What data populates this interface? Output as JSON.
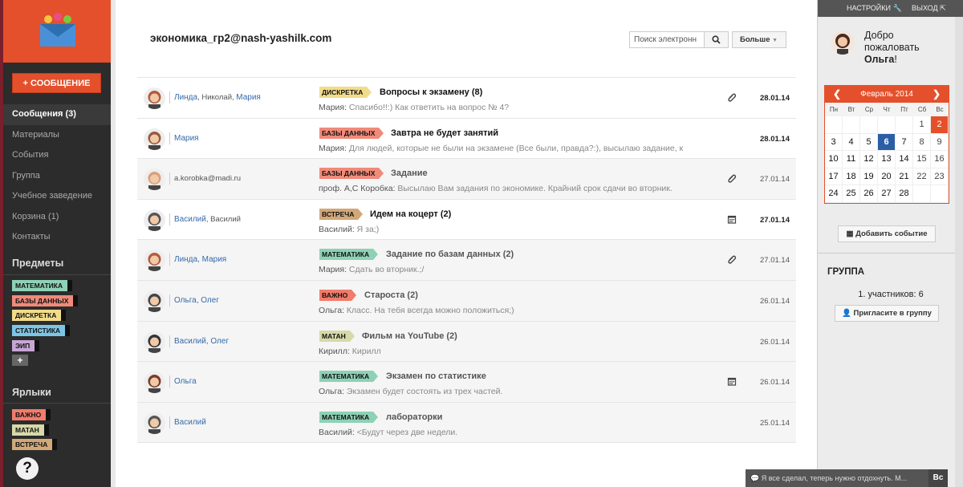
{
  "sidebar": {
    "compose_label": "+ СООБЩЕНИЕ",
    "nav": [
      {
        "label": "Сообщения (3)",
        "active": true
      },
      {
        "label": "Материалы",
        "active": false
      },
      {
        "label": "События",
        "active": false
      },
      {
        "label": "Группа",
        "active": false
      },
      {
        "label": "Учебное заведение",
        "active": false
      },
      {
        "label": "Корзина (1)",
        "active": false
      },
      {
        "label": "Контакты",
        "active": false
      }
    ],
    "subjects_title": "Предметы",
    "subjects": [
      {
        "label": "МАТЕМАТИКА",
        "color": "#8ed1b6"
      },
      {
        "label": "БАЗЫ ДАННЫХ",
        "color": "#f08a7a"
      },
      {
        "label": "ДИСКРЕТКА",
        "color": "#f2dc8a"
      },
      {
        "label": "СТАТИСТИКА",
        "color": "#7cc5e6"
      },
      {
        "label": "ЭИП",
        "color": "#c7a6d6"
      }
    ],
    "add_label": "+",
    "labels_title": "Ярлыки",
    "labels": [
      {
        "label": "ВАЖНО",
        "color": "#f27b6b"
      },
      {
        "label": "МАТАН",
        "color": "#d7d9a8"
      },
      {
        "label": "ВСТРЕЧА",
        "color": "#d2a878"
      }
    ],
    "help_label": "?"
  },
  "main": {
    "mailbox": "экономика_гр2@nash-yashilk.com",
    "search_placeholder": "Поиск электронн",
    "more_label": "Больше",
    "messages": [
      {
        "from": "Линда",
        "from_gray": ", Николай, ",
        "from2": "Мария",
        "tag": "ДИСКРЕТКА",
        "tag_color": "#f2dc8a",
        "subject": "Вопросы к экзамену (8)",
        "sender": "Мария:",
        "preview": " Спасибо!!:) Как ответить на вопрос № 4?",
        "icon": "paperclip-icon",
        "date": "28.01.14",
        "read": false,
        "avatar": "#b45a3c"
      },
      {
        "from": "Мария",
        "from_gray": "",
        "from2": "",
        "tag": "БАЗЫ ДАННЫХ",
        "tag_color": "#f08a7a",
        "subject": "Завтра не будет занятий",
        "sender": "Мария:",
        "preview": " Для людей, которые не были на экзамене (Все были, правда?:), высылаю задание, к",
        "icon": "",
        "date": "28.01.14",
        "read": false,
        "avatar": "#9a5a3a"
      },
      {
        "from": "",
        "from_gray": "a.korobka@madi.ru",
        "from2": "",
        "tag": "БАЗЫ ДАННЫХ",
        "tag_color": "#f08a7a",
        "subject": "Задание",
        "sender": "проф. А,С Коробка:",
        "preview": " Высылаю Вам задания по экономике. Крайний срок сдачи во вторник.",
        "icon": "paperclip-icon",
        "date": "27.01.14",
        "read": true,
        "avatar": "#d9a07a"
      },
      {
        "from": "Василий",
        "from_gray": ", Василий",
        "from2": "",
        "tag": "ВСТРЕЧА",
        "tag_color": "#d2a878",
        "subject": "Идем на коцерт (2)",
        "sender": "Василий:",
        "preview": " Я за;)",
        "icon": "calendar-icon",
        "date": "27.01.14",
        "read": false,
        "avatar": "#555555"
      },
      {
        "from": "Линда, Мария",
        "from_gray": "",
        "from2": "",
        "tag": "МАТЕМАТИКА",
        "tag_color": "#8ed1b6",
        "subject": "Задание по базам данных (2)",
        "sender": "Мария:",
        "preview": " Сдать во вторник.;/",
        "icon": "paperclip-icon",
        "date": "27.01.14",
        "read": true,
        "avatar": "#b45a3c"
      },
      {
        "from": "Ольга, Олег",
        "from_gray": "",
        "from2": "",
        "tag": "ВАЖНО",
        "tag_color": "#f27b6b",
        "subject": "Староста (2)",
        "sender": "Ольга:",
        "preview": " Класс. На тебя всегда можно положиться;)",
        "icon": "",
        "date": "26.01.14",
        "read": true,
        "avatar": "#444444"
      },
      {
        "from": "Василий, Олег",
        "from_gray": "",
        "from2": "",
        "tag": "МАТАН",
        "tag_color": "#d7d9a8",
        "subject": "Фильм на YouTube (2)",
        "sender": "Кирилл:",
        "preview": " Кирилл",
        "icon": "",
        "date": "26.01.14",
        "read": true,
        "avatar": "#333333"
      },
      {
        "from": "Ольга",
        "from_gray": "",
        "from2": "",
        "tag": "МАТЕМАТИКА",
        "tag_color": "#8ed1b6",
        "subject": "Экзамен по статистике",
        "sender": "Ольга:",
        "preview": " Экзамен будет состоять из трех частей.",
        "icon": "calendar-icon",
        "date": "26.01.14",
        "read": true,
        "avatar": "#7a3b2a"
      },
      {
        "from": "Василий",
        "from_gray": "",
        "from2": "",
        "tag": "МАТЕМАТИКА",
        "tag_color": "#8ed1b6",
        "subject": "лабораторки",
        "sender": "Василий:",
        "preview": " <Будут через две недели.",
        "icon": "",
        "date": "25.01.14",
        "read": true,
        "avatar": "#555555"
      }
    ]
  },
  "right": {
    "settings": "НАСТРОЙКИ",
    "logout": "ВЫХОД",
    "welcome_1": "Добро",
    "welcome_2": "пожаловать",
    "welcome_name": "Ольга",
    "welcome_excl": "!",
    "calendar": {
      "month": "Февраль 2014",
      "prev": "❮",
      "next": "❯",
      "dows": [
        "Пн",
        "Вт",
        "Ср",
        "Чт",
        "Пт",
        "Сб",
        "Вс"
      ],
      "days": [
        "",
        "",
        "",
        "",
        "",
        "1",
        "2",
        "3",
        "4",
        "5",
        "6",
        "7",
        "8",
        "9",
        "10",
        "11",
        "12",
        "13",
        "14",
        "15",
        "16",
        "17",
        "18",
        "19",
        "20",
        "21",
        "22",
        "23",
        "24",
        "25",
        "26",
        "27",
        "28",
        "",
        ""
      ],
      "today": "6",
      "selected": "2"
    },
    "add_event": "Добавить событие",
    "group_title": "ГРУППА",
    "group_count": "1. участников: 6",
    "invite": "Пригласите в группу"
  },
  "chat": {
    "text": "Я все сделал, теперь нужно отдохнуть. М...",
    "btn": "Вс"
  }
}
